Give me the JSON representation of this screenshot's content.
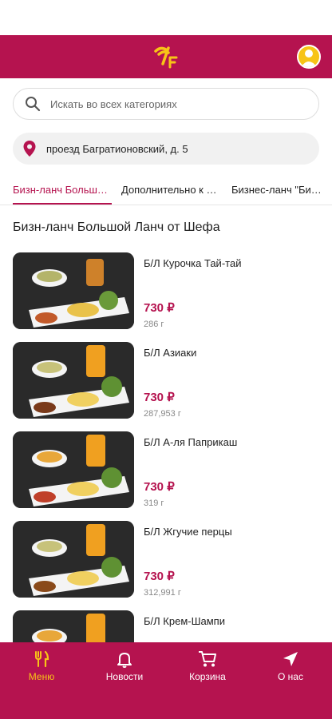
{
  "header": {
    "logo_alt": "",
    "colors": {
      "brand": "#b5134f",
      "accent": "#f7c417"
    }
  },
  "search": {
    "placeholder": "Искать во всех категориях",
    "icon": "search-icon"
  },
  "address": {
    "text": "проезд Багратионовский, д. 5",
    "icon": "location-pin-icon"
  },
  "tabs": [
    {
      "label": "Бизн-ланч Большой Ланч от Шефа",
      "active": true
    },
    {
      "label": "Дополнительно к блюдам",
      "active": false
    },
    {
      "label": "Бизнес-ланч \"Биф-Ланч\"",
      "active": false
    }
  ],
  "section": {
    "title": "Бизн-ланч Большой Ланч от Шефа"
  },
  "items": [
    {
      "name": "Б/Л Курочка Тай-тай",
      "price": "730 ₽",
      "weight": "286 г"
    },
    {
      "name": "Б/Л Азиаки",
      "price": "730 ₽",
      "weight": "287,953 г"
    },
    {
      "name": "Б/Л А-ля Паприкаш",
      "price": "730 ₽",
      "weight": "319 г"
    },
    {
      "name": "Б/Л Жгучие перцы",
      "price": "730 ₽",
      "weight": "312,991 г"
    },
    {
      "name": "Б/Л Крем-Шампи",
      "price": "",
      "weight": ""
    }
  ],
  "nav": [
    {
      "label": "Меню",
      "icon": "fork-knife-icon",
      "active": true
    },
    {
      "label": "Новости",
      "icon": "bell-icon",
      "active": false
    },
    {
      "label": "Корзина",
      "icon": "cart-icon",
      "active": false
    },
    {
      "label": "О нас",
      "icon": "navigation-arrow-icon",
      "active": false
    }
  ]
}
